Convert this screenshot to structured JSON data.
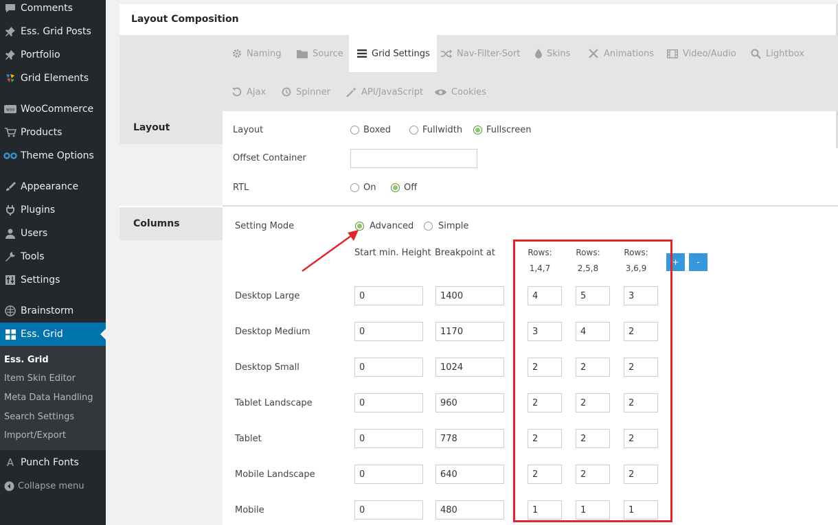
{
  "sidebar": {
    "items": [
      {
        "label": "Comments",
        "icon": "comment-icon"
      },
      {
        "label": "Ess. Grid Posts",
        "icon": "pin-icon"
      },
      {
        "label": "Portfolio",
        "icon": "pin-icon"
      },
      {
        "label": "Grid Elements",
        "icon": "grid-elements-icon"
      },
      {
        "label": "WooCommerce",
        "icon": "woo-icon"
      },
      {
        "label": "Products",
        "icon": "cart-icon"
      },
      {
        "label": "Theme Options",
        "icon": "infinity-icon"
      },
      {
        "label": "Appearance",
        "icon": "brush-icon"
      },
      {
        "label": "Plugins",
        "icon": "plug-icon"
      },
      {
        "label": "Users",
        "icon": "user-icon"
      },
      {
        "label": "Tools",
        "icon": "wrench-icon"
      },
      {
        "label": "Settings",
        "icon": "sliders-icon"
      },
      {
        "label": "Brainstorm",
        "icon": "brainstorm-icon"
      },
      {
        "label": "Ess. Grid",
        "icon": "grid-icon"
      }
    ],
    "submenu": [
      "Ess. Grid",
      "Item Skin Editor",
      "Meta Data Handling",
      "Search Settings",
      "Import/Export"
    ],
    "punch_fonts": "Punch Fonts",
    "punch_fonts_glyph": "A",
    "collapse": "Collapse menu"
  },
  "panel": {
    "title": "Layout Composition",
    "tabs_row1": [
      "Naming",
      "Source",
      "Grid Settings",
      "Nav-Filter-Sort",
      "Skins",
      "Animations",
      "Video/Audio",
      "Lightbox"
    ],
    "tabs_row2": [
      "Ajax",
      "Spinner",
      "API/JavaScript",
      "Cookies"
    ],
    "active_tab": "Grid Settings"
  },
  "layout_section": {
    "label": "Layout",
    "layout_label": "Layout",
    "layout_options": [
      "Boxed",
      "Fullwidth",
      "Fullscreen"
    ],
    "layout_selected": "Fullscreen",
    "offset_label": "Offset Container",
    "offset_value": "",
    "rtl_label": "RTL",
    "rtl_options": [
      "On",
      "Off"
    ],
    "rtl_selected": "Off"
  },
  "columns_section": {
    "label": "Columns",
    "setting_mode_label": "Setting Mode",
    "mode_options": [
      "Advanced",
      "Simple"
    ],
    "mode_selected": "Advanced",
    "col_start_height": "Start min. Height",
    "col_breakpoint": "Breakpoint at",
    "rows_heads": [
      {
        "title": "Rows:",
        "sub": "1,4,7"
      },
      {
        "title": "Rows:",
        "sub": "2,5,8"
      },
      {
        "title": "Rows:",
        "sub": "3,6,9"
      }
    ],
    "add_button": "+",
    "remove_button": "-",
    "devices": [
      {
        "name": "Desktop Large",
        "min_height": "0",
        "breakpoint": "1400",
        "rows": [
          "4",
          "5",
          "3"
        ]
      },
      {
        "name": "Desktop Medium",
        "min_height": "0",
        "breakpoint": "1170",
        "rows": [
          "3",
          "4",
          "2"
        ]
      },
      {
        "name": "Desktop Small",
        "min_height": "0",
        "breakpoint": "1024",
        "rows": [
          "2",
          "2",
          "2"
        ]
      },
      {
        "name": "Tablet Landscape",
        "min_height": "0",
        "breakpoint": "960",
        "rows": [
          "2",
          "2",
          "2"
        ]
      },
      {
        "name": "Tablet",
        "min_height": "0",
        "breakpoint": "778",
        "rows": [
          "2",
          "2",
          "2"
        ]
      },
      {
        "name": "Mobile Landscape",
        "min_height": "0",
        "breakpoint": "640",
        "rows": [
          "2",
          "2",
          "2"
        ]
      },
      {
        "name": "Mobile",
        "min_height": "0",
        "breakpoint": "480",
        "rows": [
          "1",
          "1",
          "1"
        ]
      }
    ]
  },
  "colors": {
    "sidebar_bg": "#23282d",
    "active_menu": "#0073aa",
    "accent_button": "#3498db",
    "annotation_red": "#e0262d",
    "radio_selected": "#8fc56a"
  }
}
